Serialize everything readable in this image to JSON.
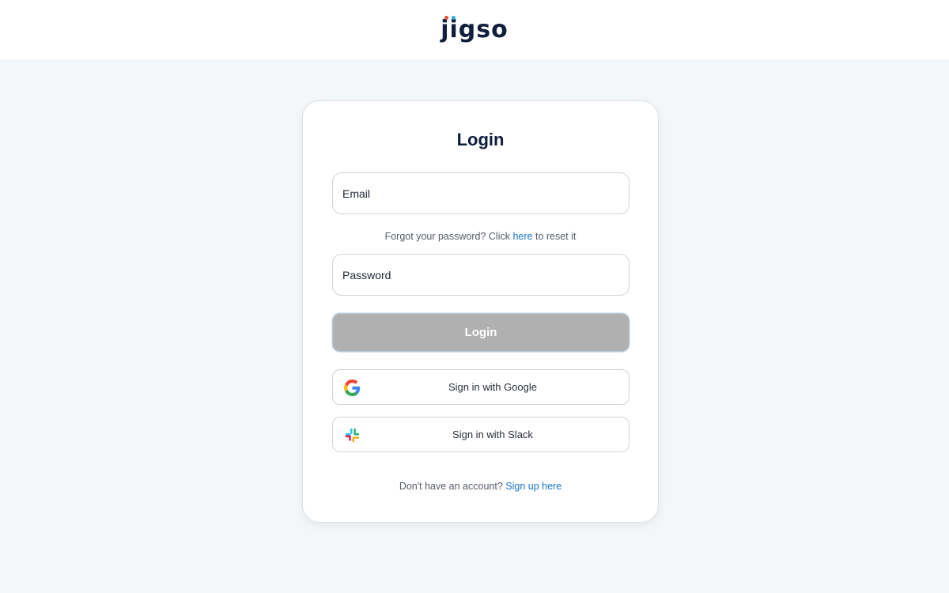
{
  "brand": {
    "logo_text": "jigso",
    "dot_colors": [
      "#e74c3c",
      "#2ea8e0"
    ]
  },
  "login": {
    "title": "Login",
    "email_placeholder": "Email",
    "forgot_prefix": "Forgot your password? Click ",
    "forgot_link": "here",
    "forgot_suffix": " to reset it",
    "password_placeholder": "Password",
    "submit_label": "Login",
    "google_label": "Sign in with Google",
    "slack_label": "Sign in with Slack",
    "signup_prefix": "Don't have an account? ",
    "signup_link": "Sign up here"
  },
  "colors": {
    "link": "#1a73c7",
    "button_disabled": "#b0b0b0",
    "heading": "#0f1e3d"
  },
  "icons": {
    "google": "google-icon",
    "slack": "slack-icon"
  }
}
